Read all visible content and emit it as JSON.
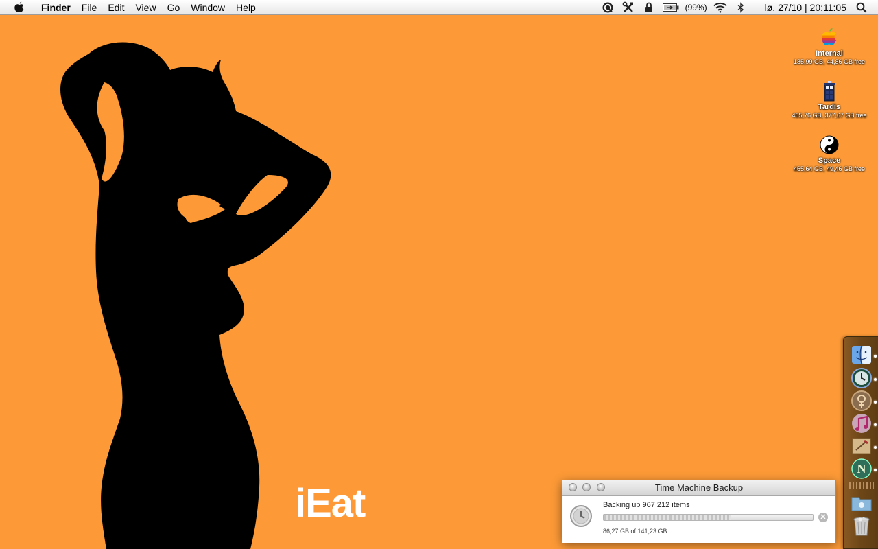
{
  "menubar": {
    "app_name": "Finder",
    "menus": [
      "File",
      "Edit",
      "View",
      "Go",
      "Window",
      "Help"
    ],
    "battery_percent": "(99%)",
    "clock": "lø. 27/10 | 20:11:05",
    "icons": [
      "apple-icon",
      "quicksilver-icon",
      "tools-icon",
      "lock-icon",
      "battery-icon",
      "wifi-icon",
      "bluetooth-icon",
      "spotlight-icon"
    ]
  },
  "wallpaper": {
    "text": "iEat",
    "background_color": "#fd9a37"
  },
  "desktop": {
    "drives": [
      {
        "name": "Internal",
        "capacity": "185,99 GB, 44,86 GB free",
        "icon": "rainbow-apple-icon"
      },
      {
        "name": "Tardis",
        "capacity": "465,76 GB, 377,67 GB free",
        "icon": "police-box-icon"
      },
      {
        "name": "Space",
        "capacity": "465,64 GB, 49,46 GB free",
        "icon": "yin-yang-icon"
      }
    ]
  },
  "dock": {
    "items": [
      "finder-icon",
      "time-machine-icon",
      "adium-icon",
      "itunes-icon",
      "mail-icon",
      "nethack-icon",
      "downloads-folder-icon",
      "trash-icon"
    ]
  },
  "time_machine": {
    "title": "Time Machine Backup",
    "status": "Backing up 967 212 items",
    "size_text": "86,27 GB of 141,23 GB",
    "progress": 0.61
  }
}
